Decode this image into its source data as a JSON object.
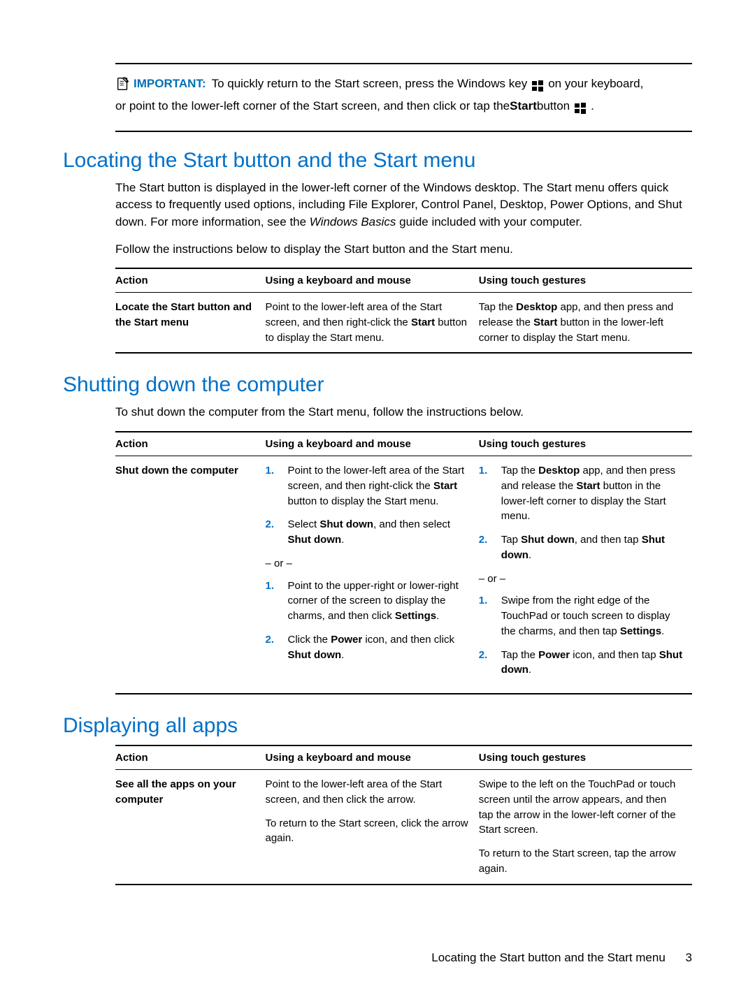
{
  "important": {
    "label": "IMPORTANT:",
    "part1": "To quickly return to the Start screen, press the Windows key",
    "part2": "on your keyboard,",
    "part3_a": "or point to the lower-left corner of the Start screen, and then click or tap the ",
    "part3_b_bold": "Start",
    "part3_c": " button",
    "part3_d": "."
  },
  "section1": {
    "title": "Locating the Start button and the Start menu",
    "para1_a": "The Start button is displayed in the lower-left corner of the Windows desktop. The Start menu offers quick access to frequently used options, including File Explorer, Control Panel, Desktop, Power Options, and Shut down. For more information, see the ",
    "para1_b_italic": "Windows Basics",
    "para1_c": " guide included with your computer.",
    "para2": "Follow the instructions below to display the Start button and the Start menu.",
    "headers": {
      "c1": "Action",
      "c2": "Using a keyboard and mouse",
      "c3": "Using touch gestures"
    },
    "row1": {
      "action": "Locate the Start button and the Start menu",
      "km_a": "Point to the lower-left area of the Start screen, and then right-click the ",
      "km_b_bold": "Start",
      "km_c": " button to display the Start menu.",
      "tg_a": "Tap the ",
      "tg_b_bold": "Desktop",
      "tg_c": " app, and then press and release the ",
      "tg_d_bold": "Start",
      "tg_e": " button in the lower-left corner to display the Start menu."
    }
  },
  "section2": {
    "title": "Shutting down the computer",
    "para1": "To shut down the computer from the Start menu, follow the instructions below.",
    "headers": {
      "c1": "Action",
      "c2": "Using a keyboard and mouse",
      "c3": "Using touch gestures"
    },
    "row1": {
      "action": "Shut down the computer",
      "km_step1_a": "Point to the lower-left area of the Start screen, and then right-click the ",
      "km_step1_b_bold": "Start",
      "km_step1_c": " button to display the Start menu.",
      "km_step2_a": "Select ",
      "km_step2_b_bold": "Shut down",
      "km_step2_c": ", and then select ",
      "km_step2_d_bold": "Shut down",
      "km_step2_e": ".",
      "km_or": "– or –",
      "km_step3_a": "Point to the upper-right or lower-right corner of the screen to display the charms, and then click ",
      "km_step3_b_bold": "Settings",
      "km_step3_c": ".",
      "km_step4_a": "Click the ",
      "km_step4_b_bold": "Power",
      "km_step4_c": " icon, and then click ",
      "km_step4_d_bold": "Shut down",
      "km_step4_e": ".",
      "tg_step1_a": "Tap the ",
      "tg_step1_b_bold": "Desktop",
      "tg_step1_c": " app, and then press and release the ",
      "tg_step1_d_bold": "Start",
      "tg_step1_e": " button in the lower-left corner to display the Start menu.",
      "tg_step2_a": "Tap ",
      "tg_step2_b_bold": "Shut down",
      "tg_step2_c": ", and then tap ",
      "tg_step2_d_bold": "Shut down",
      "tg_step2_e": ".",
      "tg_or": "– or –",
      "tg_step3_a": "Swipe from the right edge of the TouchPad or touch screen to display the charms, and then tap ",
      "tg_step3_b_bold": "Settings",
      "tg_step3_c": ".",
      "tg_step4_a": "Tap the ",
      "tg_step4_b_bold": "Power",
      "tg_step4_c": " icon, and then tap ",
      "tg_step4_d_bold": "Shut down",
      "tg_step4_e": "."
    }
  },
  "section3": {
    "title": "Displaying all apps",
    "headers": {
      "c1": "Action",
      "c2": "Using a keyboard and mouse",
      "c3": "Using touch gestures"
    },
    "row1": {
      "action": "See all the apps on your computer",
      "km_p1": "Point to the lower-left area of the Start screen, and then click the arrow.",
      "km_p2": "To return to the Start screen, click the arrow again.",
      "tg_p1": "Swipe to the left on the TouchPad or touch screen until the arrow appears, and then tap the arrow in the lower-left corner of the Start screen.",
      "tg_p2": "To return to the Start screen, tap the arrow again."
    }
  },
  "footer": {
    "text": "Locating the Start button and the Start menu",
    "page": "3"
  }
}
